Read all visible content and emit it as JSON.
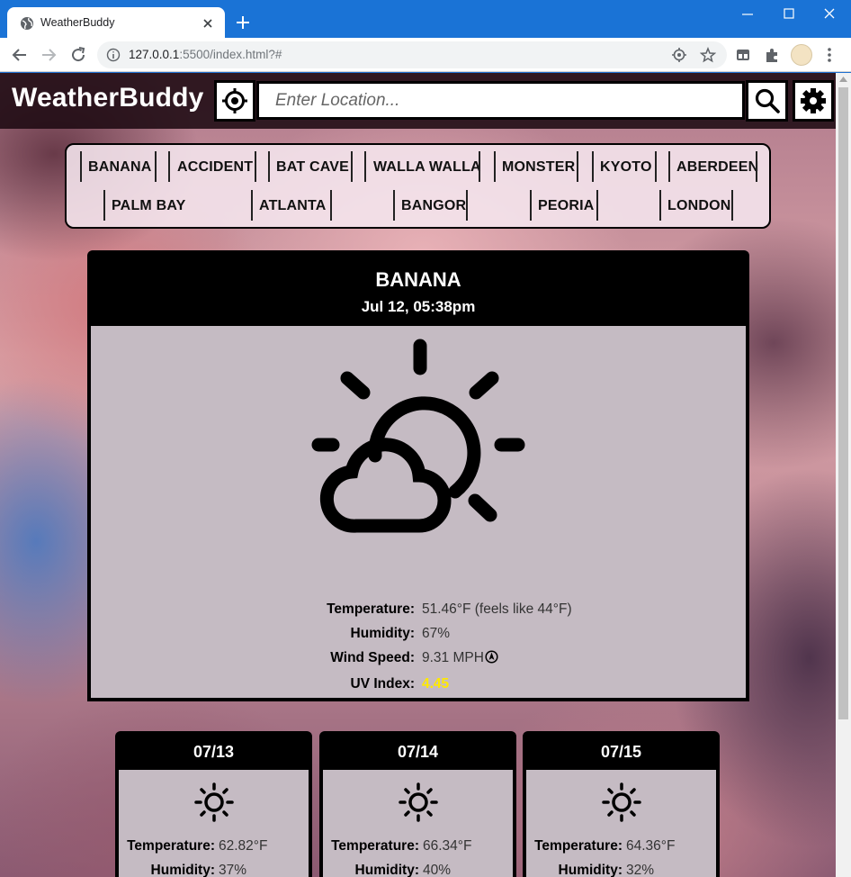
{
  "browser": {
    "tab_title": "WeatherBuddy",
    "url_host": "127.0.0.1",
    "url_rest": ":5500/index.html?#"
  },
  "app": {
    "title": "WeatherBuddy",
    "search_placeholder": "Enter Location...",
    "icons": {
      "geolocate": "crosshair-icon",
      "search": "magnifier-icon",
      "settings": "gear-icon"
    }
  },
  "cities": [
    "BANANA",
    "ACCIDENT",
    "BAT CAVE",
    "WALLA WALLA",
    "MONSTER",
    "KYOTO",
    "ABERDEEN",
    "PALM BAY",
    "ATLANTA",
    "BANGOR",
    "PEORIA",
    "LONDON"
  ],
  "current": {
    "city": "BANANA",
    "datetime": "Jul 12, 05:38pm",
    "icon": "partly-cloudy-icon",
    "stats": {
      "temperature_label": "Temperature:",
      "temperature_value": "51.46°F (feels like 44°F)",
      "humidity_label": "Humidity:",
      "humidity_value": "67%",
      "wind_label": "Wind Speed:",
      "wind_value": "9.31 MPH",
      "uv_label": "UV Index:",
      "uv_value": "4.45"
    },
    "uv_color": "#ffe900"
  },
  "forecast": [
    {
      "date": "07/13",
      "icon": "sun-icon",
      "temperature_label": "Temperature:",
      "temperature": "62.82°F",
      "humidity_label": "Humidity:",
      "humidity": "37%"
    },
    {
      "date": "07/14",
      "icon": "sun-icon",
      "temperature_label": "Temperature:",
      "temperature": "66.34°F",
      "humidity_label": "Humidity:",
      "humidity": "40%"
    },
    {
      "date": "07/15",
      "icon": "sun-icon",
      "temperature_label": "Temperature:",
      "temperature": "64.36°F",
      "humidity_label": "Humidity:",
      "humidity": "32%"
    }
  ]
}
